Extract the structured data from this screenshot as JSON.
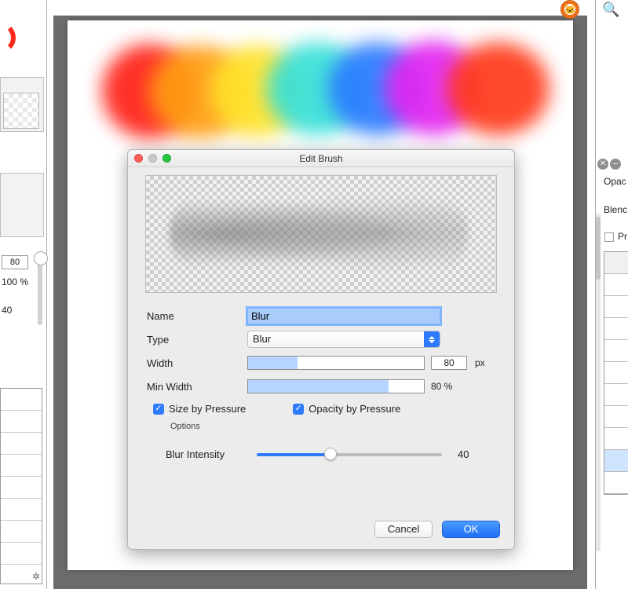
{
  "left": {
    "value_80": "80",
    "value_100pct": "100 %",
    "value_40": "40"
  },
  "right": {
    "opacity_label": "Opac",
    "blend_label": "Blenc",
    "preserve_label": "Pr"
  },
  "dialog": {
    "title": "Edit Brush",
    "name_label": "Name",
    "name_value": "Blur",
    "type_label": "Type",
    "type_value": "Blur",
    "width_label": "Width",
    "width_value": "80",
    "width_unit": "px",
    "width_fill_pct": 28,
    "minwidth_label": "Min Width",
    "minwidth_pct_text": "80 %",
    "minwidth_fill_pct": 80,
    "size_pressure_label": "Size by Pressure",
    "opacity_pressure_label": "Opacity by Pressure",
    "options_legend": "Options",
    "blur_intensity_label": "Blur Intensity",
    "blur_intensity_value": "40",
    "blur_intensity_pct": 40,
    "cancel": "Cancel",
    "ok": "OK"
  }
}
